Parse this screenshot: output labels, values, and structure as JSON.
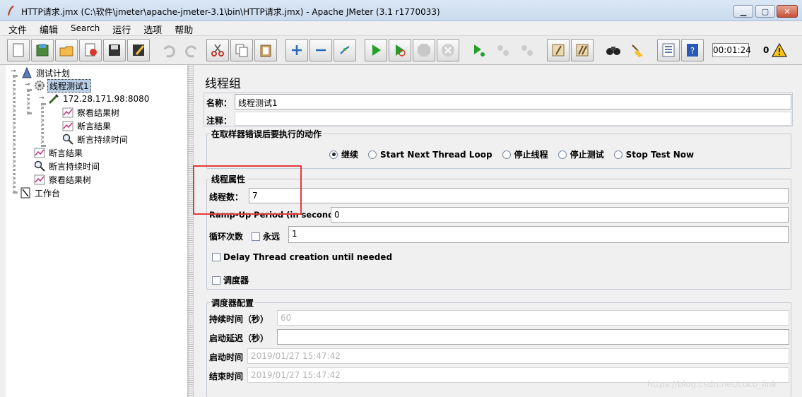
{
  "window": {
    "title": "HTTP请求.jmx (C:\\软件\\jmeter\\apache-jmeter-3.1\\bin\\HTTP请求.jmx) - Apache JMeter (3.1 r1770033)"
  },
  "menu": [
    "文件",
    "编辑",
    "Search",
    "运行",
    "选项",
    "帮助"
  ],
  "toolbar": {
    "timer": "00:01:24",
    "error_count": "0"
  },
  "tree": {
    "nodes": [
      {
        "label": "测试计划",
        "icon": "test-plan-icon"
      },
      {
        "label": "线程测试1",
        "icon": "thread-group-gear-icon"
      },
      {
        "label": "172.28.171.98:8080",
        "icon": "http-sampler-pipette-icon"
      },
      {
        "label": "察看结果树",
        "icon": "listener-chart-icon"
      },
      {
        "label": "断言结果",
        "icon": "listener-chart-icon"
      },
      {
        "label": "断言持续时间",
        "icon": "magnifier-icon"
      },
      {
        "label": "断言结果",
        "icon": "listener-chart-icon"
      },
      {
        "label": "断言持续时间",
        "icon": "magnifier-icon"
      },
      {
        "label": "察看结果树",
        "icon": "listener-chart-icon"
      },
      {
        "label": "工作台",
        "icon": "workbench-icon"
      }
    ]
  },
  "panel": {
    "heading": "线程组",
    "name_label": "名称：",
    "name_value": "线程测试1",
    "comment_label": "注释：",
    "comment_value": "",
    "error_action": {
      "title": "在取样器错误后要执行的动作",
      "options": [
        "继续",
        "Start Next Thread Loop",
        "停止线程",
        "停止测试",
        "Stop Test Now"
      ],
      "selected": "继续"
    },
    "thread_props": {
      "title": "线程属性",
      "threads_label": "线程数：",
      "threads_value": "7",
      "rampup_label": "Ramp-Up Period (in seconds):",
      "rampup_value": "0",
      "loop_label": "循环次数",
      "forever_label": "永远",
      "loop_value": "1",
      "delay_label": "Delay Thread creation until needed",
      "scheduler_label": "调度器"
    },
    "scheduler": {
      "title": "调度器配置",
      "duration_label": "持续时间（秒）",
      "duration_value": "60",
      "startup_delay_label": "启动延迟（秒）",
      "startup_delay_value": "",
      "start_time_label": "启动时间",
      "start_time_value": "2019/01/27 15:47:42",
      "end_time_label": "结束时间",
      "end_time_value": "2019/01/27 15:47:42"
    },
    "watermark": "https://blog.csdn.net/coco_link"
  },
  "colors": {
    "highlight_box": "#e23a3a",
    "selection": "#b8cfe5"
  }
}
